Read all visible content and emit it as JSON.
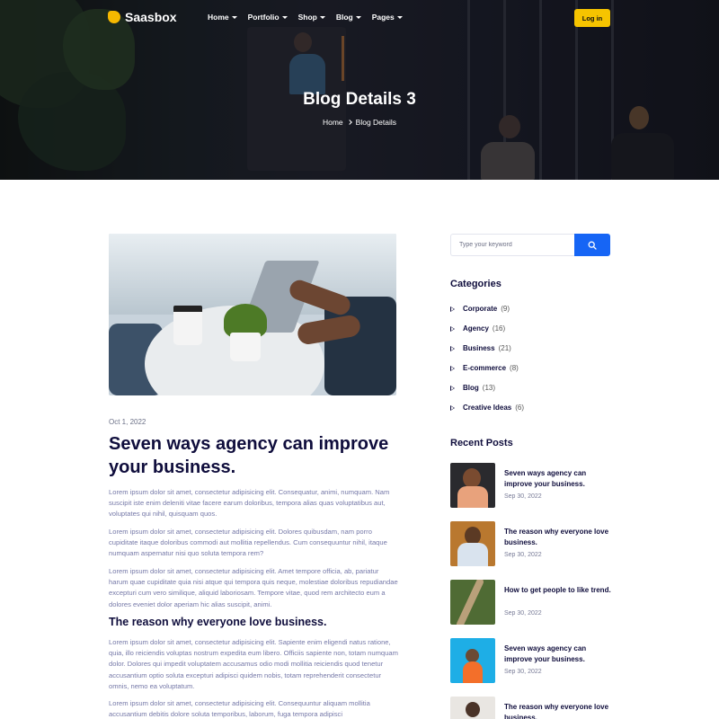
{
  "nav": {
    "logo": "Saasbox",
    "items": [
      "Home",
      "Portfolio",
      "Shop",
      "Blog",
      "Pages"
    ],
    "login": "Log in"
  },
  "hero": {
    "title": "Blog Details 3",
    "breadcrumb": [
      "Home",
      "Blog Details"
    ]
  },
  "post": {
    "date": "Oct 1, 2022",
    "title": "Seven ways agency can improve your business.",
    "paragraphs": [
      "Lorem ipsum dolor sit amet, consectetur adipisicing elit. Consequatur, animi, numquam. Nam suscipit iste enim deleniti vitae facere earum doloribus, tempora alias quas voluptatibus aut, voluptates qui nihil, quisquam quos.",
      "Lorem ipsum dolor sit amet, consectetur adipisicing elit. Dolores quibusdam, nam porro cupiditate itaque doloribus commodi aut mollitia repellendus. Cum consequuntur nihil, itaque numquam aspernatur nisi quo soluta tempora rem?",
      "Lorem ipsum dolor sit amet, consectetur adipisicing elit. Amet tempore officia, ab, pariatur harum quae cupiditate quia nisi atque qui tempora quis neque, molestiae doloribus repudiandae excepturi cum vero similique, aliquid laboriosam. Tempore vitae, quod rem architecto eum a dolores eveniet dolor aperiam hic alias suscipit, animi.",
      "Lorem ipsum dolor sit amet, consectetur adipisicing elit. Sapiente enim eligendi natus ratione, quia, illo reiciendis voluptas nostrum expedita eum libero. Officiis sapiente non, totam numquam dolor. Dolores qui impedit voluptatem accusamus odio modi mollitia reiciendis quod tenetur accusantium optio soluta excepturi adipisci quidem nobis, totam reprehenderit consectetur omnis, nemo ea voluptatum.",
      "Lorem ipsum dolor sit amet, consectetur adipisicing elit. Consequuntur aliquam mollitia accusantium debitis dolore soluta temporibus, laborum, fuga tempora adipisci"
    ],
    "subheading": "The reason why everyone love business."
  },
  "sidebar": {
    "search_placeholder": "Type your keyword",
    "categories_title": "Categories",
    "categories": [
      {
        "name": "Corporate",
        "count": "(9)"
      },
      {
        "name": "Agency",
        "count": "(16)"
      },
      {
        "name": "Business",
        "count": "(21)"
      },
      {
        "name": "E-commerce",
        "count": "(8)"
      },
      {
        "name": "Blog",
        "count": "(13)"
      },
      {
        "name": "Creative Ideas",
        "count": "(6)"
      }
    ],
    "recent_title": "Recent Posts",
    "recent": [
      {
        "title": "Seven ways agency can improve your business.",
        "date": "Sep 30, 2022"
      },
      {
        "title": "The reason why everyone love business.",
        "date": "Sep 30, 2022"
      },
      {
        "title": "How to get people to like trend.",
        "date": "Sep 30, 2022"
      },
      {
        "title": "Seven ways agency can improve your business.",
        "date": "Sep 30, 2022"
      },
      {
        "title": "The reason why everyone love business.",
        "date": ""
      }
    ]
  },
  "colors": {
    "accent_yellow": "#f6c400",
    "accent_blue": "#1665f5",
    "heading": "#0f0d3c",
    "body_text": "#7679a8"
  },
  "icons": {
    "search": "search-icon",
    "caret": "caret-down-icon",
    "breadcrumb_sep": "chevron-right-icon",
    "category_bullet": "triangle-right-icon"
  }
}
